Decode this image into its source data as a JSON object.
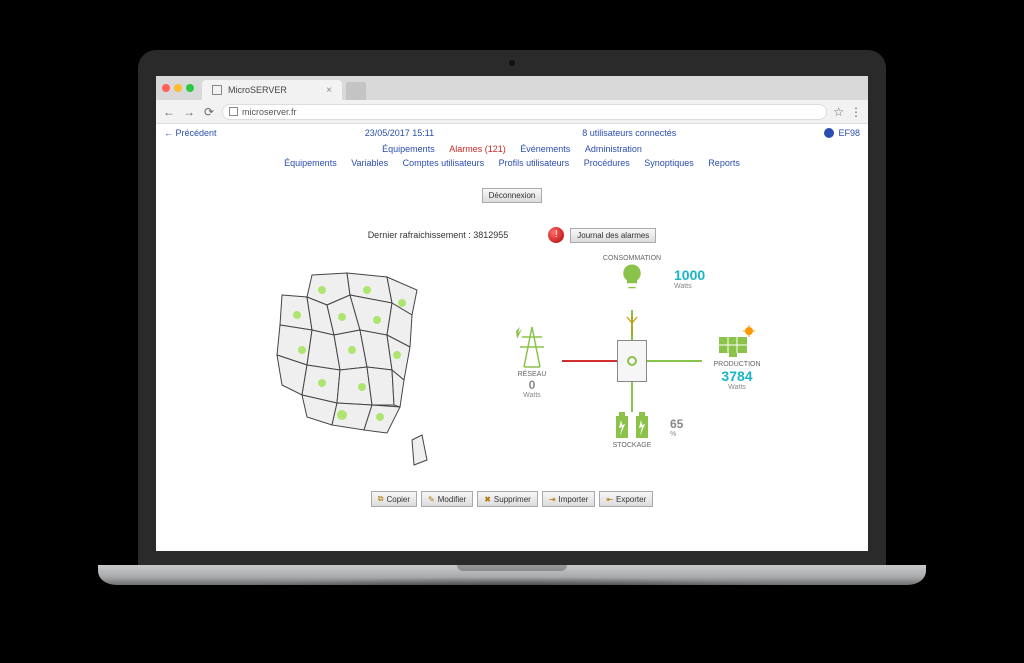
{
  "browser": {
    "tab_title": "MicroSERVER",
    "url": "microserver.fr"
  },
  "header": {
    "back": "← Précédent",
    "datetime": "23/05/2017 15:11",
    "users_connected": "8 utilisateurs connectés",
    "username": "EF98"
  },
  "nav1": {
    "equip": "Équipements",
    "alarmes": "Alarmes (121)",
    "even": "Événements",
    "admin": "Administration"
  },
  "nav2": {
    "equip": "Équipements",
    "vars": "Variables",
    "comptes": "Comptes utilisateurs",
    "profils": "Profils utilisateurs",
    "proc": "Procédures",
    "syn": "Synoptiques",
    "reports": "Reports"
  },
  "buttons": {
    "disconnect": "Déconnexion",
    "journal": "Journal des alarmes",
    "copier": "Copier",
    "modifier": "Modifier",
    "supprimer": "Supprimer",
    "importer": "Importer",
    "exporter": "Exporter"
  },
  "refresh": {
    "label": "Dernier rafraichissement : 3812955"
  },
  "energy": {
    "consommation": {
      "label": "CONSOMMATION",
      "value": "1000",
      "unit": "Watts",
      "color": "#1ab5c9"
    },
    "reseau": {
      "label": "RÉSEAU",
      "value": "0",
      "unit": "Watts",
      "color": "#888"
    },
    "production": {
      "label": "PRODUCTION",
      "value": "3784",
      "unit": "Watts",
      "color": "#1ab5c9"
    },
    "stockage": {
      "label": "STOCKAGE",
      "value": "65",
      "unit": "%",
      "color": "#888"
    }
  }
}
